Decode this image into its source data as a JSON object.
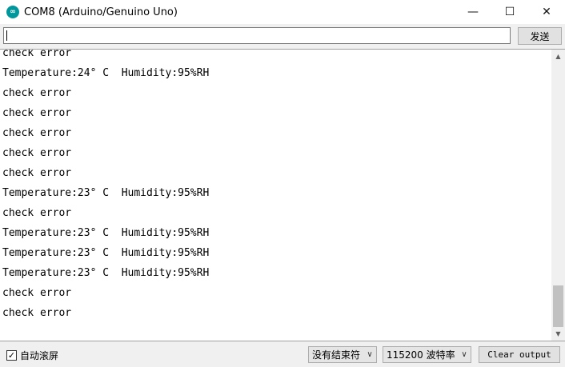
{
  "window": {
    "title": "COM8 (Arduino/Genuino Uno)",
    "icon_glyph": "∞",
    "minimize": "—",
    "maximize": "☐",
    "close": "✕"
  },
  "send_bar": {
    "input_value": "",
    "send_label": "发送"
  },
  "output": {
    "lines": [
      "check error",
      "Temperature:24° C  Humidity:95%RH",
      "check error",
      "check error",
      "check error",
      "check error",
      "check error",
      "Temperature:23° C  Humidity:95%RH",
      "check error",
      "Temperature:23° C  Humidity:95%RH",
      "Temperature:23° C  Humidity:95%RH",
      "Temperature:23° C  Humidity:95%RH",
      "check error",
      "check error"
    ]
  },
  "scrollbar": {
    "up": "▲",
    "down": "▼"
  },
  "bottom_bar": {
    "autoscroll_checked": "✓",
    "autoscroll_label": "自动滚屏",
    "line_ending": "没有结束符",
    "baud_rate": "115200 波特率",
    "chevron": "∨",
    "clear_label": "Clear output"
  }
}
